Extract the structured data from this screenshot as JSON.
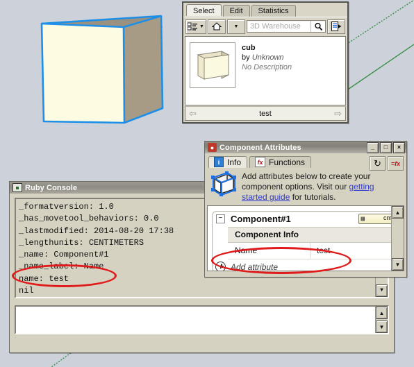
{
  "app": {
    "background_color": "#ccd1da",
    "axis_line_color": "#2f8a3c"
  },
  "model": {
    "cube": {
      "front_face_color": "#fdfce3",
      "side_face_color": "#a79b85",
      "top_face_color": "#9b9180",
      "selection_edge_color": "#1d8fe8",
      "selected": true
    }
  },
  "component_browser": {
    "tabs": [
      {
        "label": "Select",
        "active": true
      },
      {
        "label": "Edit",
        "active": false
      },
      {
        "label": "Statistics",
        "active": false
      }
    ],
    "toolbar": {
      "view_options_icon": "list-view-icon",
      "view_options_dropdown_icon": "chevron-down-icon",
      "home_icon": "home-icon",
      "home_dropdown_icon": "chevron-down-icon",
      "search_placeholder": "3D Warehouse",
      "search_value": "",
      "search_icon": "magnifier-icon",
      "details_icon": "details-flyout-icon"
    },
    "item": {
      "thumbnail_icon": "cube-thumbnail",
      "name": "cub",
      "by_prefix": "by ",
      "author": "Unknown",
      "description": "No Description"
    },
    "footer": {
      "prev_icon": "arrow-left-icon",
      "label": "test",
      "next_icon": "arrow-right-icon"
    }
  },
  "ruby_console": {
    "title": "Ruby Console",
    "title_icon": "console-icon",
    "output_lines": [
      "_formatversion: 1.0",
      "_has_movetool_behaviors: 0.0",
      "_lastmodified: 2014-08-20 17:38",
      "_lengthunits: CENTIMETERS",
      "_name: Component#1",
      "_name_label: Name",
      "name: test",
      "nil"
    ],
    "input_value": "",
    "scroll_up_icon": "scroll-up-icon",
    "scroll_down_icon": "scroll-down-icon"
  },
  "component_attributes": {
    "title": "Component Attributes",
    "title_icon": "sketchup-logo-icon",
    "window_buttons": {
      "minimize": "_",
      "maximize": "□",
      "close": "×"
    },
    "tabs": [
      {
        "label": "Info",
        "icon": "info-icon",
        "active": true
      },
      {
        "label": "Functions",
        "icon": "fx-icon",
        "active": false
      }
    ],
    "tools": [
      {
        "name": "refresh-icon",
        "glyph": "↻"
      },
      {
        "name": "formula-icon",
        "glyph": "=fx"
      }
    ],
    "help": {
      "icon": "component-cube-icon",
      "text_before": "Add attributes below to create your component options. Visit our ",
      "link_text": "getting started guide",
      "text_after": " for tutorials."
    },
    "attribute_card": {
      "expander": "−",
      "title": "Component#1",
      "unit_chip": "cm",
      "group_label": "Component Info",
      "rows": [
        {
          "key": "Name",
          "value": "test"
        }
      ],
      "add_attribute_label": "Add attribute",
      "add_attribute_icon": "add-circle-icon"
    },
    "scroll_up_icon": "scroll-up-icon",
    "scroll_down_icon": "scroll-down-icon"
  },
  "annotations": [
    {
      "name": "console-name-highlight",
      "shape": "ellipse",
      "color": "#e01b1b",
      "targets": "name: test"
    },
    {
      "name": "attribute-name-highlight",
      "shape": "ellipse",
      "color": "#e01b1b",
      "targets": "Name / test row"
    }
  ]
}
